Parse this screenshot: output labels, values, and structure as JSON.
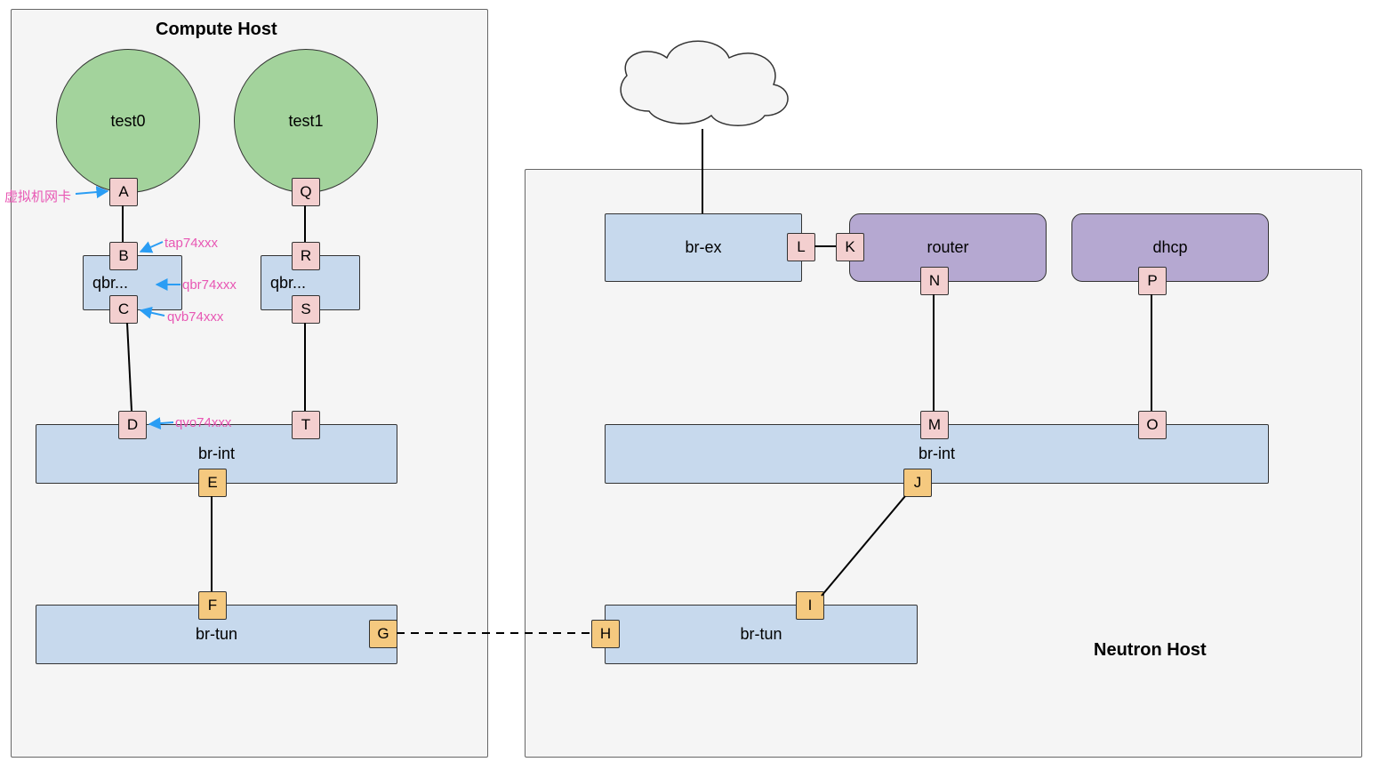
{
  "hosts": {
    "compute": {
      "title": "Compute Host"
    },
    "neutron": {
      "title": "Neutron Host"
    }
  },
  "vms": {
    "test0": {
      "label": "test0"
    },
    "test1": {
      "label": "test1"
    }
  },
  "bridges": {
    "qbr_left": {
      "label": "qbr..."
    },
    "qbr_right": {
      "label": "qbr..."
    },
    "br_int_left": {
      "label": "br-int"
    },
    "br_tun_left": {
      "label": "br-tun"
    },
    "br_ex": {
      "label": "br-ex"
    },
    "br_int_right": {
      "label": "br-int"
    },
    "br_tun_right": {
      "label": "br-tun"
    },
    "router": {
      "label": "router"
    },
    "dhcp": {
      "label": "dhcp"
    }
  },
  "ports": {
    "A": "A",
    "B": "B",
    "C": "C",
    "D": "D",
    "E": "E",
    "F": "F",
    "G": "G",
    "H": "H",
    "I": "I",
    "J": "J",
    "K": "K",
    "L": "L",
    "M": "M",
    "N": "N",
    "O": "O",
    "P": "P",
    "Q": "Q",
    "R": "R",
    "S": "S",
    "T": "T"
  },
  "annotations": {
    "vnic": "虚拟机网卡",
    "tap": "tap74xxx",
    "qbr": "qbr74xxx",
    "qvb": "qvb74xxx",
    "qvo": "qvo74xxx"
  },
  "colors": {
    "host_bg": "#f5f5f5",
    "vm_fill": "#a3d39c",
    "bridge_blue": "#c7d9ed",
    "service_purple": "#b5a8d1",
    "port_pink": "#f3cfcf",
    "port_orange": "#f5c97f",
    "annotation": "#e857b4",
    "arrow": "#2a9df4"
  }
}
